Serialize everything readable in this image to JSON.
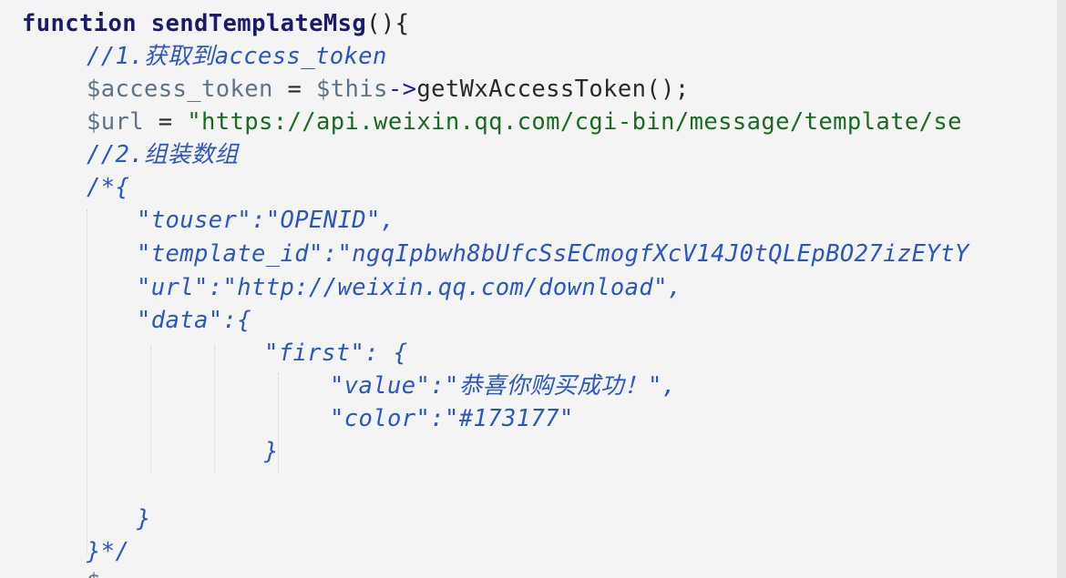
{
  "code": {
    "line1": {
      "kw": "function",
      "name": "sendTemplateMsg",
      "punc": "(){"
    },
    "line2": {
      "comment": "//1.获取到access_token"
    },
    "line3": {
      "var1": "$access_token",
      "eq": " = ",
      "var2": "$this",
      "arrow": "->",
      "call": "getWxAccessToken();"
    },
    "line4": {
      "var": "$url",
      "eq": " = ",
      "str": "\"https://api.weixin.qq.com/cgi-bin/message/template/se"
    },
    "line5": {
      "comment": "//2.组装数组"
    },
    "line6": {
      "comment": "/*{"
    },
    "line7": {
      "comment": "\"touser\":\"OPENID\","
    },
    "line8": {
      "comment": "\"template_id\":\"ngqIpbwh8bUfcSsECmogfXcV14J0tQLEpBO27izEYtY"
    },
    "line9": {
      "comment": "\"url\":\"http://weixin.qq.com/download\","
    },
    "line10": {
      "comment": "\"data\":{"
    },
    "line11": {
      "comment": "\"first\": {"
    },
    "line12": {
      "comment": "\"value\":\"恭喜你购买成功！\","
    },
    "line13": {
      "comment": "\"color\":\"#173177\""
    },
    "line14": {
      "comment": "}"
    },
    "line15": {
      "comment": "}"
    },
    "line16": {
      "comment": "}*/"
    },
    "line17": {
      "partial": "$"
    }
  }
}
